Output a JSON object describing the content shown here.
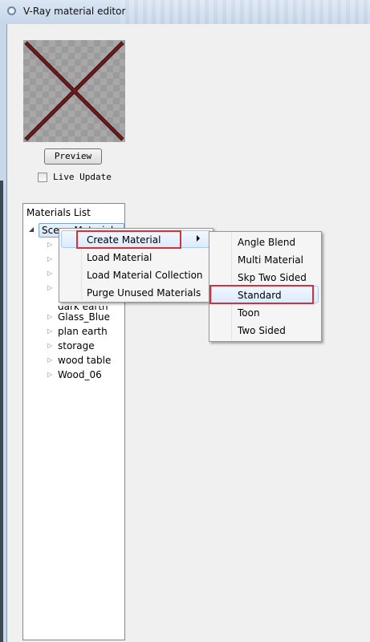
{
  "window": {
    "title": "V-Ray material editor"
  },
  "preview": {
    "button_label": "Preview",
    "live_update_label": "Live Update",
    "live_update_checked": false
  },
  "materials_list": {
    "header": "Materials List",
    "root_label": "Scene Materials",
    "items": [
      "dark earth",
      "Glass_Blue",
      "plan earth",
      "storage",
      "wood table",
      "Wood_06"
    ]
  },
  "context_menu": {
    "items": [
      "Create Material",
      "Load Material",
      "Load Material Collection",
      "Purge Unused Materials"
    ]
  },
  "submenu": {
    "items": [
      "Angle Blend",
      "Multi Material",
      "Skp Two Sided",
      "Standard",
      "Toon",
      "Two Sided"
    ]
  },
  "colors": {
    "highlight_border": "#d8303a",
    "selection": "#dcebfc",
    "preview_cross": "#4a1414"
  }
}
